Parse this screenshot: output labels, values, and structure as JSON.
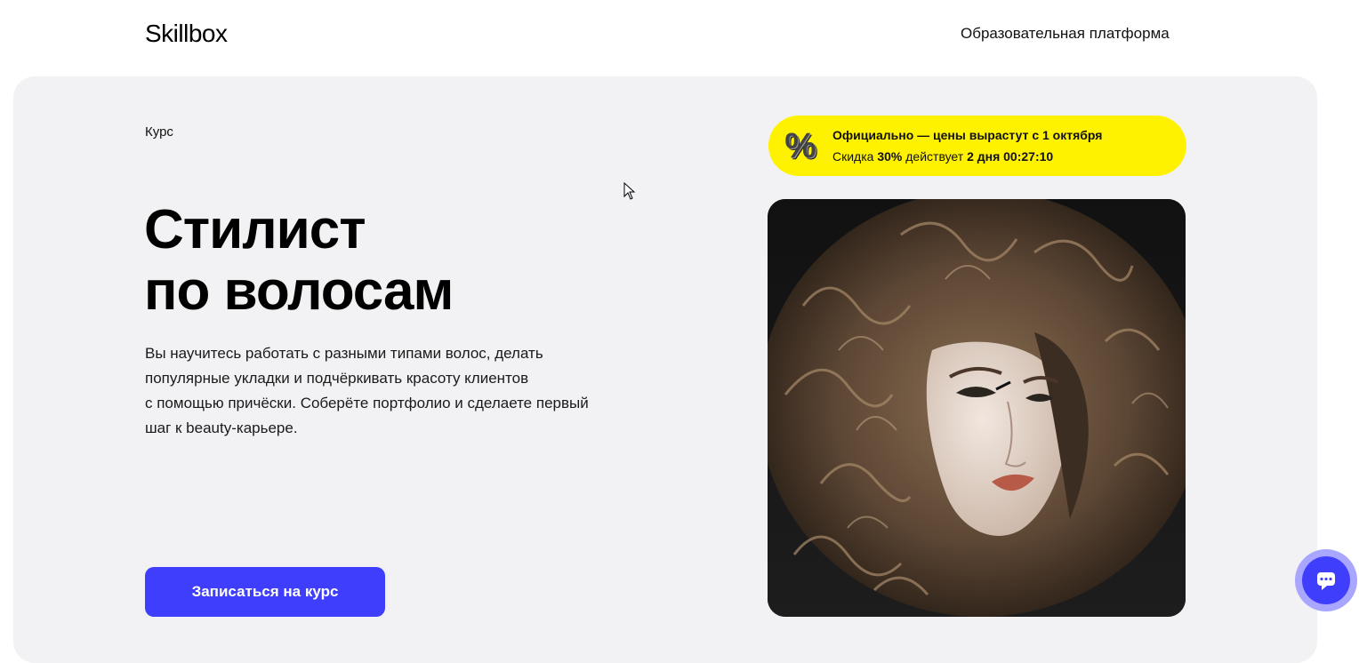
{
  "header": {
    "logo": "Skillbox",
    "nav_link": "Образовательная платформа"
  },
  "hero": {
    "kicker": "Курс",
    "title_lines": [
      "Стилист",
      "по волосам"
    ],
    "description_lines": [
      "Вы научитесь работать с разными типами волос, делать",
      "популярные укладки и подчёркивать красоту клиентов",
      "с помощью причёски. Соберёте портфолио и сделаете первый",
      "шаг к beauty-карьере."
    ],
    "cta_label": "Записаться на курс"
  },
  "promo": {
    "icon": "%",
    "line1": "Официально — цены вырастут с 1 октября",
    "line2_prefix": "Скидка",
    "discount": "30%",
    "line2_middle": "действует",
    "days": "2 дня",
    "timer": "00:27:10"
  },
  "colors": {
    "accent": "#3f3efc",
    "promo_bg": "#fff200",
    "hero_bg": "#f2f2f4"
  },
  "icons": {
    "chat": "chat-bubble-icon",
    "promo": "percent-icon"
  }
}
